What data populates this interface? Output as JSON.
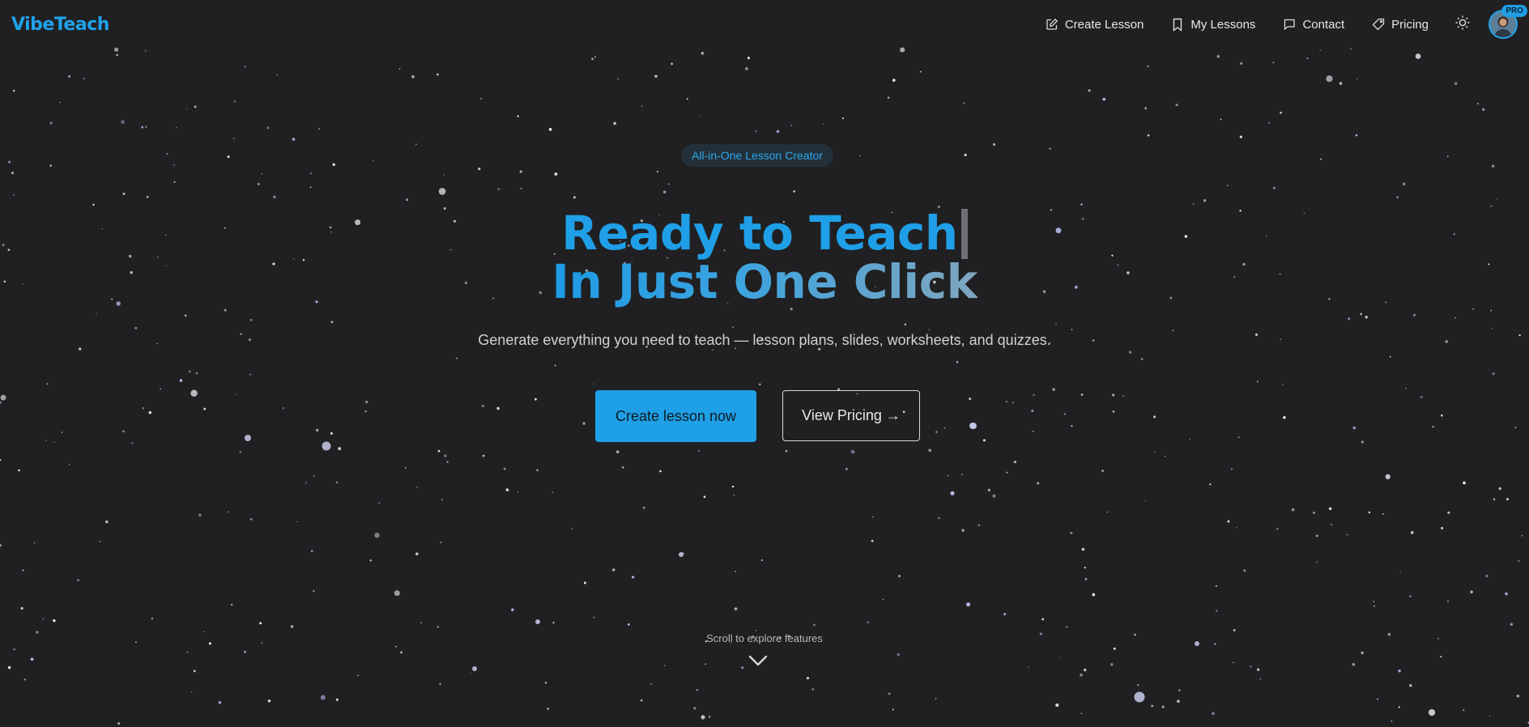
{
  "header": {
    "logo": "VibeTeach",
    "nav": [
      {
        "label": "Create Lesson",
        "icon": "edit-icon"
      },
      {
        "label": "My Lessons",
        "icon": "bookmark-icon"
      },
      {
        "label": "Contact",
        "icon": "message-icon"
      },
      {
        "label": "Pricing",
        "icon": "tag-icon"
      }
    ],
    "theme_icon": "sun-icon",
    "avatar_badge": "PRO"
  },
  "hero": {
    "badge": "All-in-One Lesson Creator",
    "headline_line1": "Ready to Teach",
    "headline_line2": "In Just One Click",
    "subtitle": "Generate everything you need to teach — lesson plans, slides, worksheets, and quizzes.",
    "primary_cta": "Create lesson now",
    "secondary_cta": "View Pricing →",
    "scroll_hint": "Scroll to explore features",
    "scroll_icon": "chevron-down-icon"
  },
  "colors": {
    "background": "#202022",
    "accent": "#1e9fe6",
    "badge_bg": "#243039"
  }
}
